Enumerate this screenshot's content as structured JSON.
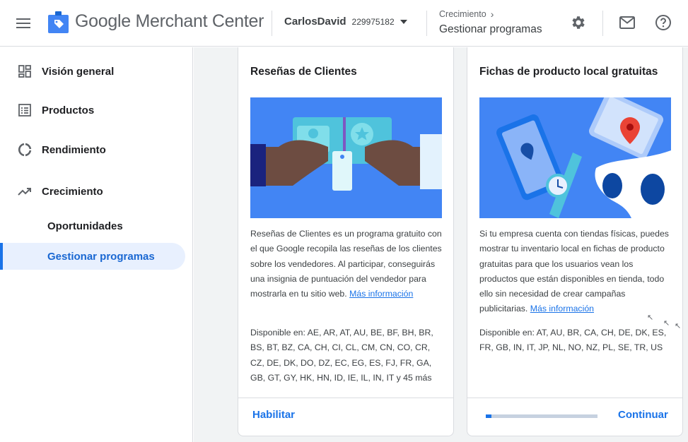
{
  "header": {
    "app_name": "Google Merchant Center",
    "account_name": "CarlosDavid",
    "account_id": "229975182",
    "breadcrumb_parent": "Crecimiento",
    "breadcrumb_title": "Gestionar programas"
  },
  "icons": {
    "menu": "hamburger-icon",
    "logo": "merchant-center-logo",
    "account_dropdown": "caret-down-icon",
    "breadcrumb_chevron": "chevron-right-icon",
    "settings": "gear-icon",
    "mail": "mail-icon",
    "help": "help-icon"
  },
  "sidebar": {
    "items": [
      {
        "label": "Visión general",
        "icon": "dashboard-icon"
      },
      {
        "label": "Productos",
        "icon": "list-icon"
      },
      {
        "label": "Rendimiento",
        "icon": "donut-chart-icon"
      },
      {
        "label": "Crecimiento",
        "icon": "trending-up-icon"
      }
    ],
    "sub_items": [
      {
        "label": "Oportunidades",
        "active": false
      },
      {
        "label": "Gestionar programas",
        "active": true
      }
    ]
  },
  "cards": [
    {
      "title": "Reseñas de Clientes",
      "description": "Reseñas de Clientes es un programa gratuito con el que Google recopila las reseñas de los clientes sobre los vendedores. Al participar, conseguirás una insignia de puntuación del vendedor para mostrarla en tu sitio web.",
      "link": "Más información",
      "availability": "Disponible en: AE, AR, AT, AU, BE, BF, BH, BR, BS, BT, BZ, CA, CH, CI, CL, CM, CN, CO, CR, CZ, DE, DK, DO, DZ, EC, EG, ES, FJ, FR, GA, GB, GT, GY, HK, HN, ID, IE, IL, IN, IT y 45 más",
      "action": "Habilitar"
    },
    {
      "title": "Fichas de producto local gratuitas",
      "description": "Si tu empresa cuenta con tiendas físicas, puedes mostrar tu inventario local en fichas de producto gratuitas para que los usuarios vean los productos que están disponibles en tienda, todo ello sin necesidad de crear campañas publicitarias.",
      "link": "Más información",
      "availability": "Disponible en: AT, AU, BR, CA, CH, DE, DK, ES, FR, GB, IN, IT, JP, NL, NO, NZ, PL, SE, TR, US",
      "action": "Continuar",
      "progress": 0.05
    }
  ],
  "colors": {
    "accent": "#1a73e8",
    "active_bg": "#e8f0fe",
    "illustration_bg": "#4285f4"
  }
}
